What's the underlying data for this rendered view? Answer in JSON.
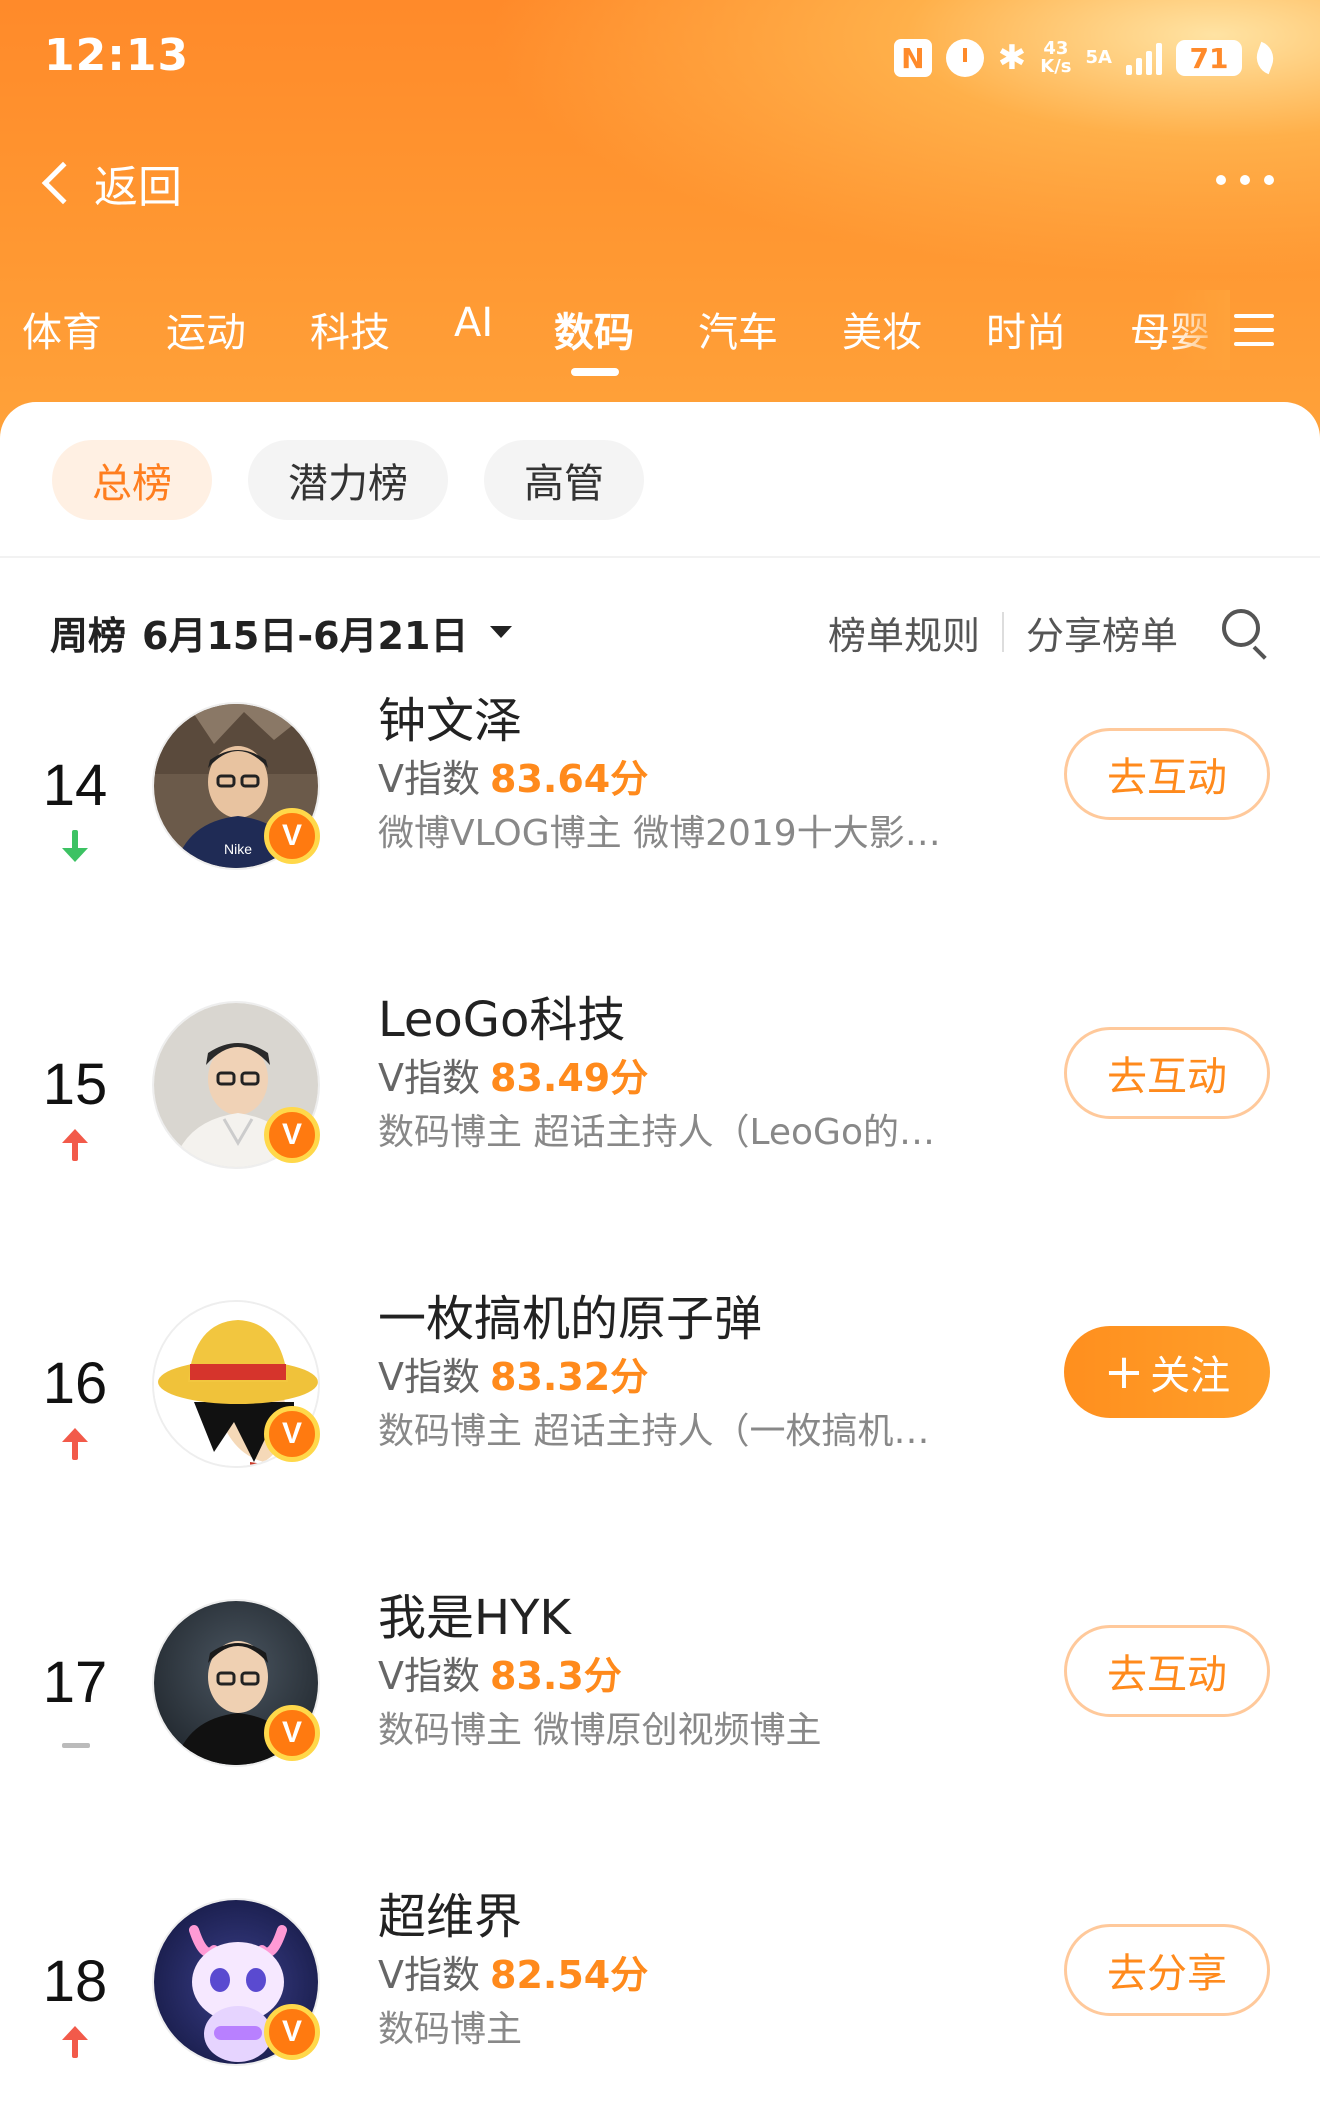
{
  "status_bar": {
    "time": "12:13",
    "nfc": "N",
    "speed_top": "43",
    "speed_bottom": "K/s",
    "network": "5A",
    "battery": "71"
  },
  "nav": {
    "back_label": "返回"
  },
  "categories": [
    {
      "label": "体育",
      "active": false
    },
    {
      "label": "运动",
      "active": false
    },
    {
      "label": "科技",
      "active": false
    },
    {
      "label": "AI",
      "active": false
    },
    {
      "label": "数码",
      "active": true
    },
    {
      "label": "汽车",
      "active": false
    },
    {
      "label": "美妆",
      "active": false
    },
    {
      "label": "时尚",
      "active": false
    },
    {
      "label": "母婴",
      "active": false
    }
  ],
  "sub_tabs": [
    {
      "label": "总榜",
      "active": true
    },
    {
      "label": "潜力榜",
      "active": false
    },
    {
      "label": "高管",
      "active": false
    }
  ],
  "filter": {
    "period": "周榜",
    "range": "6月15日-6月21日",
    "rules_label": "榜单规则",
    "share_label": "分享榜单"
  },
  "list": [
    {
      "rank": "14",
      "trend": "down",
      "name": "钟文泽",
      "vindex_label": "V指数",
      "score": "83.64分",
      "desc": "微博VLOG博主 微博2019十大影…",
      "action": "去互动",
      "action_type": "interact",
      "avatar": "avatar-photo"
    },
    {
      "rank": "15",
      "trend": "up",
      "name": "LeoGo科技",
      "vindex_label": "V指数",
      "score": "83.49分",
      "desc": "数码博主 超话主持人（LeoGo的…",
      "action": "去互动",
      "action_type": "interact",
      "avatar": "avatar-photo"
    },
    {
      "rank": "16",
      "trend": "up",
      "name": "一枚搞机的原子弹",
      "vindex_label": "V指数",
      "score": "83.32分",
      "desc": "数码博主 超话主持人（一枚搞机…",
      "action": "关注",
      "action_type": "follow",
      "avatar": "avatar-cartoon"
    },
    {
      "rank": "17",
      "trend": "same",
      "name": "我是HYK",
      "vindex_label": "V指数",
      "score": "83.3分",
      "desc": "数码博主 微博原创视频博主",
      "action": "去互动",
      "action_type": "interact",
      "avatar": "avatar-photo"
    },
    {
      "rank": "18",
      "trend": "up",
      "name": "超维界",
      "vindex_label": "V指数",
      "score": "82.54分",
      "desc": "数码博主",
      "action": "去分享",
      "action_type": "share",
      "avatar": "avatar-3d-character"
    }
  ],
  "colors": {
    "accent": "#ff8a1c",
    "header": "#ff8a2a",
    "up": "#f25a4a",
    "down": "#3cc263"
  }
}
